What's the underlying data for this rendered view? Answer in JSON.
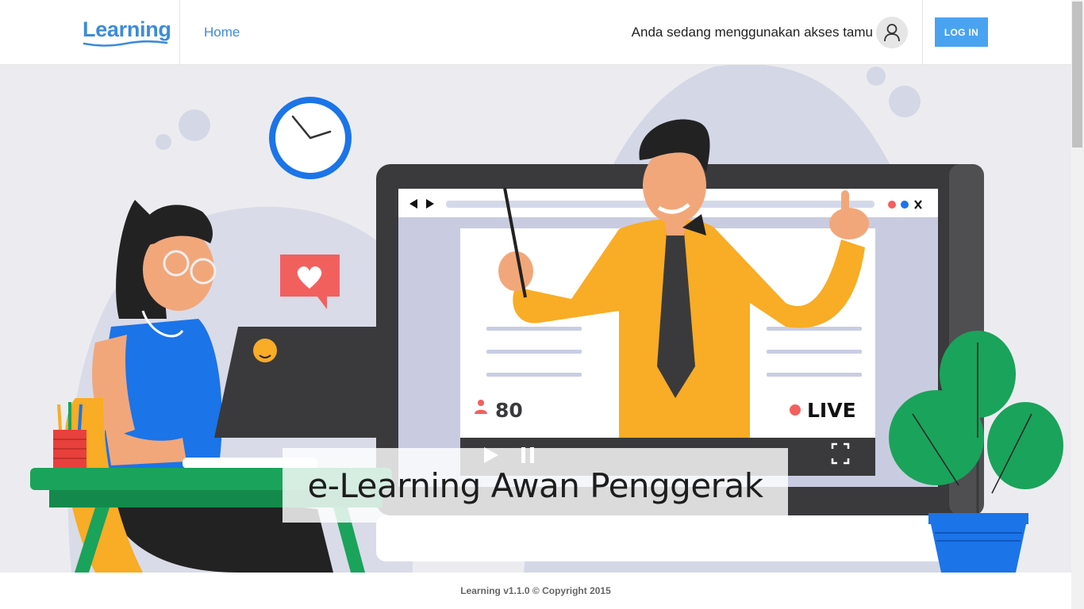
{
  "header": {
    "logo_text": "Learning",
    "nav_home": "Home",
    "guest_text": "Anda sedang menggunakan akses tamu",
    "login_label": "LOG IN"
  },
  "hero": {
    "title": "e-Learning Awan Penggerak",
    "viewer_count": "80",
    "live_label": "LIVE"
  },
  "footer": {
    "copyright": "Learning v1.1.0 © Copyright 2015"
  },
  "colors": {
    "accent": "#3d8bd9",
    "login_button": "#4aa3f0",
    "hero_background": "#ececf0"
  }
}
